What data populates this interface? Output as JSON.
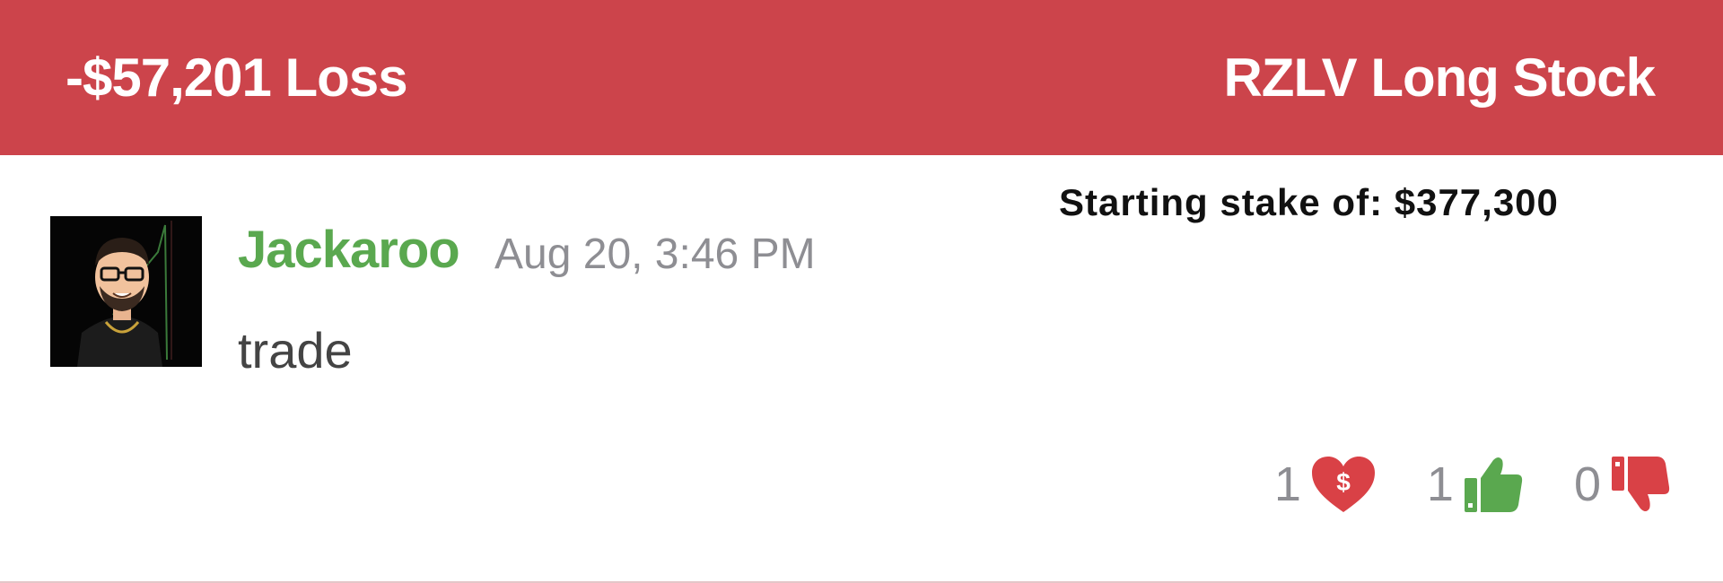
{
  "header": {
    "pl_label": "-$57,201 Loss",
    "trade_title": "RZLV Long Stock",
    "background_color": "#cc444b"
  },
  "stake_label": "Starting stake of: $377,300",
  "post": {
    "avatar_icon": "bitmoji-avatar",
    "username": "Jackaroo",
    "username_color": "#5aa84f",
    "timestamp": "Aug 20, 3:46 PM",
    "message": "trade"
  },
  "reactions": [
    {
      "icon": "dollar-heart-icon",
      "count": "1",
      "color": "#d94146"
    },
    {
      "icon": "thumbs-up-icon",
      "count": "1",
      "color": "#5aa84f"
    },
    {
      "icon": "thumbs-down-icon",
      "count": "0",
      "color": "#d94146"
    }
  ]
}
